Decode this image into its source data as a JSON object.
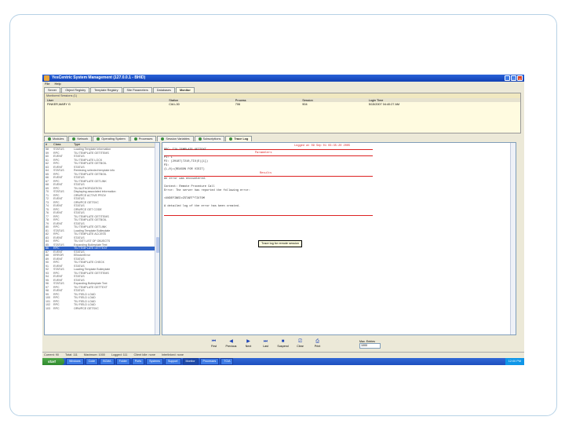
{
  "window": {
    "title": "YesCentric System Management (127.0.0.1 - BHID)",
    "controls": [
      "_",
      "□",
      "×"
    ]
  },
  "menubar": [
    "File",
    "Help"
  ],
  "top_tabs": [
    {
      "label": "Server",
      "active": false
    },
    {
      "label": "Object Registry",
      "active": false
    },
    {
      "label": "Template Registry",
      "active": false
    },
    {
      "label": "Site Parameters",
      "active": false
    },
    {
      "label": "Databases",
      "active": false
    },
    {
      "label": "Monitor",
      "active": true
    }
  ],
  "sessions": {
    "header": "Monitored Sessions (1)",
    "columns": [
      "User",
      "Station",
      "Process",
      "Session",
      "Login Time"
    ],
    "rows": [
      [
        "FINKER,MARY G",
        "CIA L30",
        "706",
        "904",
        "5/15/2007 04:40:27 AM"
      ]
    ]
  },
  "mid_tabs": [
    {
      "label": "Modules",
      "active": false
    },
    {
      "label": "Network",
      "active": false
    },
    {
      "label": "Operating System",
      "active": false
    },
    {
      "label": "Processes",
      "active": false
    },
    {
      "label": "Session Variables",
      "active": false
    },
    {
      "label": "Subscriptions",
      "active": false
    },
    {
      "label": "Trace Log",
      "active": true
    }
  ],
  "trace_grid": {
    "columns": [
      "#",
      "Class",
      "Type"
    ],
    "selected_index": 28,
    "rows": [
      [
        "58",
        "STATUS",
        "Loading Template Information"
      ],
      [
        "59",
        "RPC",
        "TIU TEMPLATE GETITEMS"
      ],
      [
        "60",
        "EVENT",
        "STATUS"
      ],
      [
        "61",
        "RPC",
        "TIU TEMPLATE LOCK"
      ],
      [
        "62",
        "RPC",
        "TIU TEMPLATE GETBOIL"
      ],
      [
        "63",
        "EVENT",
        "STATUS"
      ],
      [
        "64",
        "STATUS",
        "Retrieving selected template info"
      ],
      [
        "65",
        "RPC",
        "TIU TEMPLATE GETBOIL"
      ],
      [
        "66",
        "EVENT",
        "STATUS"
      ],
      [
        "67",
        "RPC",
        "TIU TEMPLATE GETLINK"
      ],
      [
        "68",
        "EVENT",
        "STATUS"
      ],
      [
        "69",
        "RPC",
        "TIU AUTHORIZATION"
      ],
      [
        "70",
        "STATUS",
        "Displaying associated information"
      ],
      [
        "71",
        "RPC",
        "ORWPCE ACTIVE PROV"
      ],
      [
        "72",
        "EVENT",
        "STATUS"
      ],
      [
        "73",
        "RPC",
        "ORWPCE GETSVC"
      ],
      [
        "74",
        "EVENT",
        "STATUS"
      ],
      [
        "75",
        "RPC",
        "ORWPCE GET CODE"
      ],
      [
        "76",
        "EVENT",
        "STATUS"
      ],
      [
        "77",
        "RPC",
        "TIU TEMPLATE GETITEMS"
      ],
      [
        "78",
        "RPC",
        "TIU TEMPLATE GETBOIL"
      ],
      [
        "79",
        "EVENT",
        "STATUS"
      ],
      [
        "80",
        "RPC",
        "TIU TEMPLATE GETLINK"
      ],
      [
        "81",
        "STATUS",
        "Loading Template Boilerplate"
      ],
      [
        "82",
        "RPC",
        "TIU TEMPLATE ACCESS"
      ],
      [
        "83",
        "EVENT",
        "STATUS"
      ],
      [
        "84",
        "RPC",
        "TIU GET LIST OF OBJECTS"
      ],
      [
        "85",
        "STATUS",
        "Expanding Boilerplate Text"
      ],
      [
        "86",
        "RPC",
        "TIU TEMPLATE GETTEXT"
      ],
      [
        "87",
        "EVENT",
        "STATUS"
      ],
      [
        "88",
        "ERROR",
        "EBrokerError"
      ],
      [
        "89",
        "EVENT",
        "STATUS"
      ],
      [
        "90",
        "RPC",
        "TIU TEMPLATE CHECK"
      ],
      [
        "91",
        "EVENT",
        "STATUS"
      ],
      [
        "92",
        "STATUS",
        "Loading Template Boilerplate"
      ],
      [
        "93",
        "RPC",
        "TIU TEMPLATE GETITEMS"
      ],
      [
        "94",
        "EVENT",
        "STATUS"
      ],
      [
        "95",
        "EVENT",
        "STATUS"
      ],
      [
        "96",
        "STATUS",
        "Expanding Boilerplate Text"
      ],
      [
        "97",
        "RPC",
        "TIU TEMPLATE GETTEXT"
      ],
      [
        "98",
        "EVENT",
        "STATUS"
      ],
      [
        "99",
        "RPC",
        "TIU FIELD LOAD"
      ],
      [
        "100",
        "RPC",
        "TIU FIELD LOAD"
      ],
      [
        "101",
        "RPC",
        "TIU FIELD LOAD"
      ],
      [
        "102",
        "RPC",
        "TIU FIELD LOAD"
      ],
      [
        "103",
        "RPC",
        "ORWPCE GETSVC"
      ]
    ]
  },
  "log": {
    "header": "Logged at 09 Sep 01 03:35:20 2005",
    "param_title": "Parameters",
    "lines_a": [
      "RPC: TIU TEMPLATE GETTEXT",
      "",
      "P1:  L",
      "P2:  (20187|7210,TIU|E|{L})",
      "P3:",
      "  (L,0)=(REASON FOR VISIT)"
    ],
    "result_title": "Results",
    "lines_b": [
      "An error was encountered.",
      "",
      "Context: Remote Procedure Call",
      "Error:   The server has reported the following error:",
      "",
      "<UNDEFINED>ZSTART^TIUTOM",
      "",
      "A detailed log of the error has been created."
    ],
    "tooltip": "Trace log for remote session"
  },
  "vcr_buttons": [
    {
      "icon": "first-icon",
      "glyph": "⏮",
      "label": "First"
    },
    {
      "icon": "previous-icon",
      "glyph": "◀",
      "label": "Previous"
    },
    {
      "icon": "next-icon",
      "glyph": "▶",
      "label": "Next"
    },
    {
      "icon": "last-icon",
      "glyph": "⏭",
      "label": "Last"
    },
    {
      "icon": "suspend-icon",
      "glyph": "■",
      "label": "Suspend"
    },
    {
      "icon": "clear-icon",
      "glyph": "⎚",
      "label": "Clear"
    },
    {
      "icon": "print-icon",
      "glyph": "⎙",
      "label": "Print"
    }
  ],
  "max_entries": {
    "label": "Max. Entries",
    "value": "1000"
  },
  "statusbar": [
    "Current: 90",
    "Total: 111",
    "Maximum: 1000",
    "Logged: 111",
    "Client Idle: none",
    "Interlinked: none"
  ],
  "taskbar": {
    "start": "start",
    "tasks": [
      "Windows",
      "Code",
      "BCMA",
      "Folder",
      "Ports",
      "Systems",
      "Support",
      "Monitor",
      "Processes",
      "TCIA"
    ],
    "active_task_index": 7,
    "clock": "12:00 PM"
  },
  "colors": {
    "titlebar": "#1d50c4",
    "selected_row": "#3163c5",
    "error_red": "#d22222",
    "taskbar": "#2a5ecc"
  }
}
